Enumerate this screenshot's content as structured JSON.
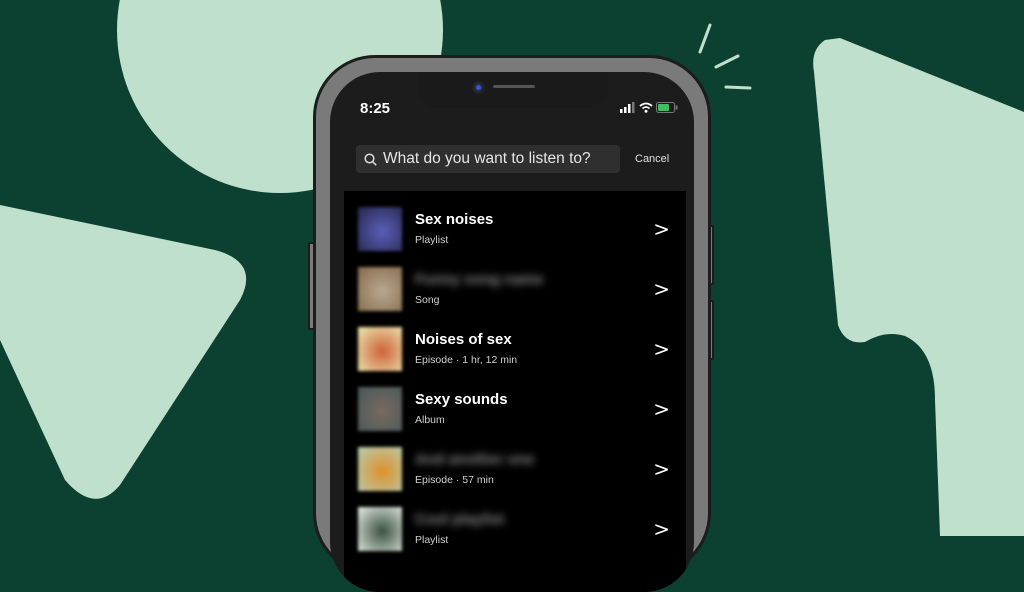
{
  "status_bar": {
    "time": "8:25"
  },
  "search": {
    "placeholder": "What do you want to listen to?",
    "cancel_label": "Cancel"
  },
  "results": [
    {
      "title": "Sex noises",
      "subtitle": "Playlist",
      "title_blurred": false,
      "thumb_colors": [
        "#5a5fb8",
        "#2a2c55"
      ]
    },
    {
      "title": "Funny song name",
      "subtitle": "Song",
      "title_blurred": true,
      "thumb_colors": [
        "#b8a890",
        "#8a7050"
      ]
    },
    {
      "title": "Noises of sex",
      "subtitle": "Episode · 1 hr, 12 min",
      "title_blurred": false,
      "thumb_colors": [
        "#d0603a",
        "#e8e0a8"
      ]
    },
    {
      "title": "Sexy sounds",
      "subtitle": "Album",
      "title_blurred": false,
      "thumb_colors": [
        "#7a6a60",
        "#4a5a5a"
      ]
    },
    {
      "title": "And another one",
      "subtitle": "Episode · 57 min",
      "title_blurred": true,
      "thumb_colors": [
        "#e0902a",
        "#b8c8a8"
      ]
    },
    {
      "title": "Cool playlist",
      "subtitle": "Playlist",
      "title_blurred": true,
      "thumb_colors": [
        "#3a5040",
        "#d8e0d8"
      ]
    }
  ],
  "colors": {
    "background": "#0c4030",
    "shape": "#bfe0cc",
    "list_bg": "#000000",
    "phone_frame": "#7a7a7a"
  }
}
